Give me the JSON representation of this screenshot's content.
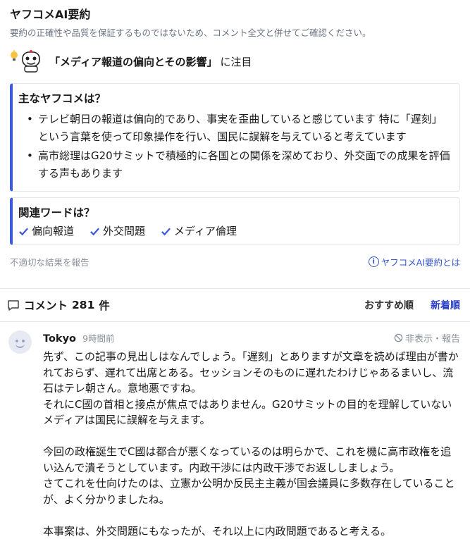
{
  "summary": {
    "title": "ヤフコメAI要約",
    "disclaimer": "要約の正確性や品質を保証するものではないため、コメント全文と併せてご確認ください。",
    "focus_topic": "「メディア報道の偏向とその影響」",
    "focus_suffix": "に注目",
    "main_title": "主なヤフコメは？",
    "main_points": [
      "テレビ朝日の報道は偏向的であり、事実を歪曲していると感じています 特に「遅刻」という言葉を使って印象操作を行い、国民に誤解を与えていると考えています",
      "高市総理はG20サミットで積極的に各国との関係を深めており、外交面での成果を評価する声もあります"
    ],
    "words_title": "関連ワードは？",
    "words": [
      "偏向報道",
      "外交問題",
      "メディア倫理"
    ],
    "report_link": "不適切な結果を報告",
    "about_link": "ヤフコメAI要約とは"
  },
  "comments_header": {
    "label": "コメント",
    "count": "281",
    "unit": "件",
    "sort_recommended": "おすすめ順",
    "sort_newest": "新着順"
  },
  "comment": {
    "user": "Tokyo",
    "time": "9時間前",
    "actions": "非表示・報告",
    "text": "先ず、この記事の見出しはなんでしょう。「遅刻」とありますが文章を読めば理由が書かれておらず、遅れて出席とある。セッションそのものに遅れたわけじゃあるまいし、流石はテレ朝さん。意地悪ですね。\nそれにC國の首相と接点が焦点ではありません。G20サミットの目的を理解していないメディアは国民に誤解を与えます。\n\n今回の政権誕生でC國は都合が悪くなっているのは明らかで、これを機に高市政権を追い込んで潰そうとしています。内政干渉には内政干渉でお返ししましょう。\nさてこれを仕向けたのは、立憲か公明か反民主主義が国会議員に多数存在していることが、よく分かりましたね。\n\n本事案は、外交問題にもなったが、それ以上に内政問題であると考える。"
  },
  "colors": {
    "accent": "#3b5bdb",
    "link": "#3555c8",
    "muted": "#8a8f98"
  }
}
